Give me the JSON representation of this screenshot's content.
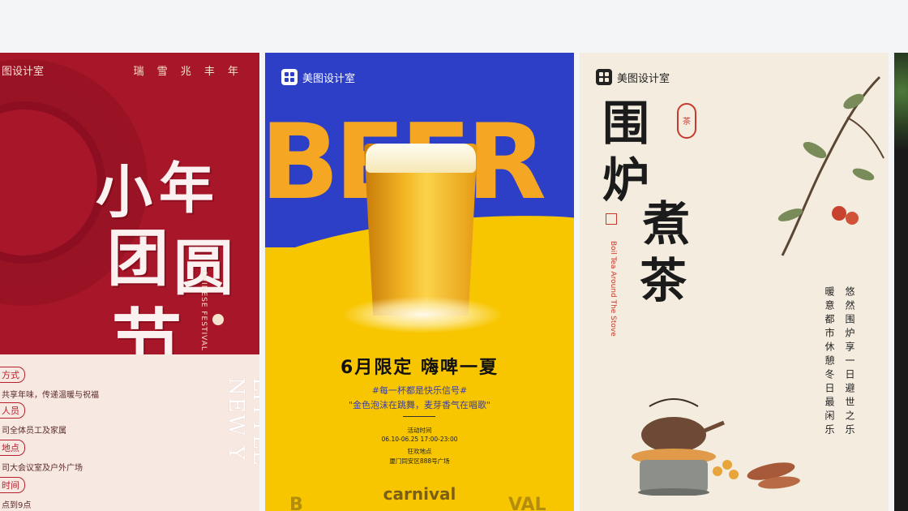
{
  "brand_name": "美图设计室",
  "cards": [
    {
      "brand": "图设计室",
      "top_right": "瑞 雪 兆 丰 年",
      "calligraphy": [
        "小",
        "年",
        "团",
        "圆",
        "节"
      ],
      "festival_en": "CHINESE FESTIVAL",
      "ghost_text": "LITTLE NEW Y",
      "info": [
        {
          "tag": "方式",
          "text": "共享年味，传递温暖与祝福"
        },
        {
          "tag": "人员",
          "text": "司全体员工及家属"
        },
        {
          "tag": "地点",
          "text": "司大会议室及户外广场"
        },
        {
          "tag": "时间",
          "text": "点到9点"
        }
      ]
    },
    {
      "big_word": "BEER",
      "headline": "6月限定  嗨啤一夏",
      "sub1": "#每一杯都是快乐信号#",
      "sub2": "\"金色泡沫在跳舞，麦芽香气在唱歌\"",
      "time_label": "活动时间",
      "time_value": "06.10-06.25 17:00-23:00",
      "place_label": "狂欢地点",
      "place_value": "厦门同安区888号广场",
      "carnival": "carnival",
      "partial_left": "B",
      "partial_right": "VAL"
    },
    {
      "title": [
        "围",
        "炉",
        "煮",
        "茶"
      ],
      "seal_char": "茶",
      "english": "Boil Tea Around The Stove",
      "poem_right": "悠然围炉享一日避世之乐",
      "poem_left": "暖意都市休憩冬日最闲乐"
    }
  ],
  "colors": {
    "card1_red": "#a8162a",
    "card2_blue": "#2d3fc7",
    "card2_yellow": "#f7c600",
    "card3_paper": "#f3ecdf"
  }
}
